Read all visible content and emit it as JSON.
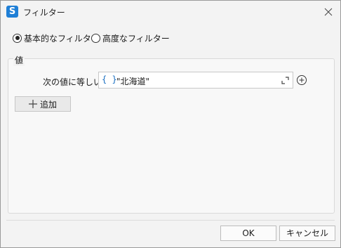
{
  "window": {
    "title": "フィルター",
    "app_icon": "S"
  },
  "filter_mode": {
    "options": [
      {
        "label": "基本的なフィルター",
        "selected": true
      },
      {
        "label": "高度なフィルター",
        "selected": false
      }
    ]
  },
  "value_group": {
    "title": "値",
    "condition_label": "次の値に等しい",
    "brace_symbol": "{ }",
    "value": "\"北海道\"",
    "add_label": "追加"
  },
  "footer": {
    "ok_label": "OK",
    "cancel_label": "キャンセル"
  },
  "colors": {
    "accent": "#1f7fd6",
    "expression": "#1a6fc2"
  },
  "icons": [
    "app-icon",
    "close-icon",
    "expand-icon",
    "plus-circle-icon",
    "plus-icon"
  ]
}
